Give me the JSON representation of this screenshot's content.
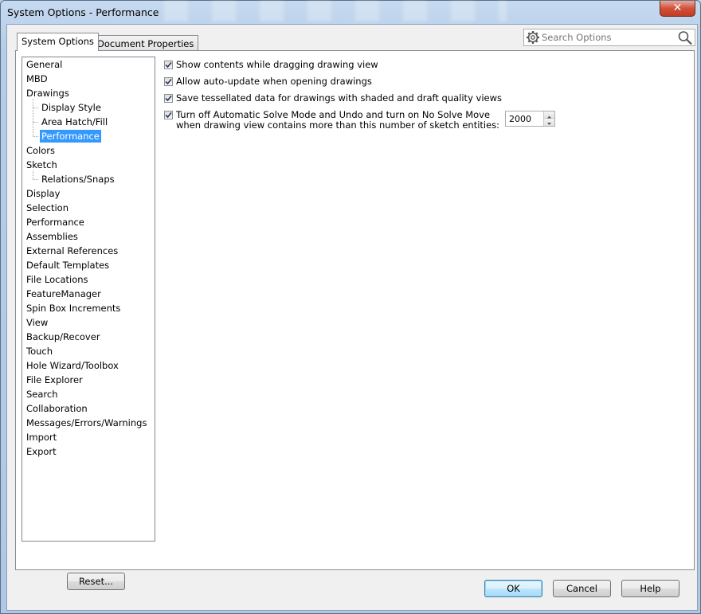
{
  "window": {
    "title": "System Options - Performance",
    "close_glyph": "✕"
  },
  "tabs": [
    {
      "label": "System Options",
      "active": true
    },
    {
      "label": "Document Properties",
      "active": false
    }
  ],
  "search": {
    "placeholder": "Search Options",
    "icon_left": "gear-icon",
    "icon_right": "magnifier-icon"
  },
  "tree": {
    "items": [
      {
        "label": "General",
        "level": 0
      },
      {
        "label": "MBD",
        "level": 0
      },
      {
        "label": "Drawings",
        "level": 0
      },
      {
        "label": "Display Style",
        "level": 1
      },
      {
        "label": "Area Hatch/Fill",
        "level": 1
      },
      {
        "label": "Performance",
        "level": 1,
        "selected": true
      },
      {
        "label": "Colors",
        "level": 0
      },
      {
        "label": "Sketch",
        "level": 0
      },
      {
        "label": "Relations/Snaps",
        "level": 1
      },
      {
        "label": "Display",
        "level": 0
      },
      {
        "label": "Selection",
        "level": 0
      },
      {
        "label": "Performance",
        "level": 0
      },
      {
        "label": "Assemblies",
        "level": 0
      },
      {
        "label": "External References",
        "level": 0
      },
      {
        "label": "Default Templates",
        "level": 0
      },
      {
        "label": "File Locations",
        "level": 0
      },
      {
        "label": "FeatureManager",
        "level": 0
      },
      {
        "label": "Spin Box Increments",
        "level": 0
      },
      {
        "label": "View",
        "level": 0
      },
      {
        "label": "Backup/Recover",
        "level": 0
      },
      {
        "label": "Touch",
        "level": 0
      },
      {
        "label": "Hole Wizard/Toolbox",
        "level": 0
      },
      {
        "label": "File Explorer",
        "level": 0
      },
      {
        "label": "Search",
        "level": 0
      },
      {
        "label": "Collaboration",
        "level": 0
      },
      {
        "label": "Messages/Errors/Warnings",
        "level": 0
      },
      {
        "label": "Import",
        "level": 0
      },
      {
        "label": "Export",
        "level": 0
      }
    ]
  },
  "reset_label": "Reset...",
  "options": [
    {
      "label": "Show contents while dragging drawing view",
      "checked": true
    },
    {
      "label": "Allow auto-update when opening drawings",
      "checked": true
    },
    {
      "label": "Save tessellated data for drawings with shaded and draft quality views",
      "checked": true
    },
    {
      "label": "Turn off Automatic Solve Mode and Undo and turn on No Solve Move",
      "label_line2": "when drawing view contains more than this number of sketch entities:",
      "checked": true
    }
  ],
  "sketch_entities_value": "2000",
  "buttons": {
    "ok": "OK",
    "cancel": "Cancel",
    "help": "Help"
  },
  "colors": {
    "selection": "#3399ff",
    "close_button": "#c23b22"
  }
}
